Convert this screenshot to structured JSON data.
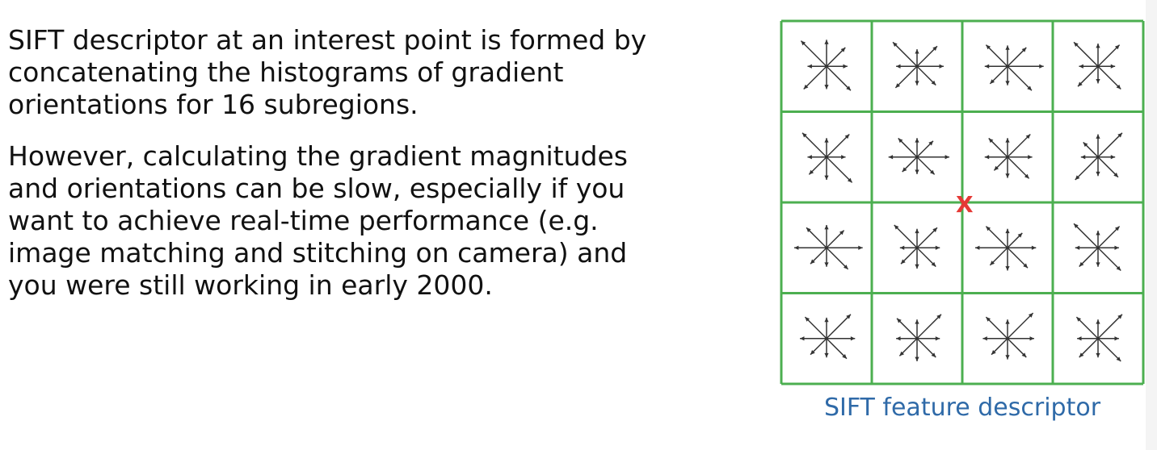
{
  "text": {
    "paragraphs": [
      [
        "SIFT descriptor at an interest point is formed by",
        "concatenating the histograms of gradient",
        "orientations for 16 subregions."
      ],
      [
        "However, calculating the gradient magnitudes",
        "and orientations can be slow, especially if you",
        "want to achieve real-time performance (e.g.",
        "image matching and stitching on camera) and",
        "you were still working in early 2000."
      ]
    ]
  },
  "figure": {
    "grid_color": "#4caf50",
    "arrow_color": "#333333",
    "center_marker": "X",
    "center_marker_color": "#e53935",
    "caption": "SIFT feature descriptor",
    "cells": [
      [
        [
          0.55,
          0.7,
          0.7,
          0.95,
          0.5,
          0.85,
          0.6,
          0.9
        ],
        [
          0.7,
          0.75,
          0.45,
          0.9,
          0.55,
          0.8,
          0.5,
          0.7
        ],
        [
          0.95,
          0.7,
          0.55,
          0.8,
          0.6,
          0.65,
          0.5,
          0.9
        ],
        [
          0.45,
          0.8,
          0.6,
          0.9,
          0.5,
          0.75,
          0.45,
          0.85
        ]
      ],
      [
        [
          0.5,
          0.85,
          0.5,
          0.9,
          0.5,
          0.65,
          0.6,
          0.95
        ],
        [
          0.85,
          0.6,
          0.5,
          0.7,
          0.75,
          0.55,
          0.45,
          0.65
        ],
        [
          0.65,
          0.85,
          0.5,
          0.7,
          0.6,
          0.5,
          0.55,
          0.8
        ],
        [
          0.45,
          0.9,
          0.6,
          0.55,
          0.45,
          0.85,
          0.5,
          0.75
        ]
      ],
      [
        [
          0.95,
          0.65,
          0.6,
          0.75,
          0.85,
          0.6,
          0.5,
          0.8
        ],
        [
          0.6,
          0.75,
          0.5,
          0.85,
          0.45,
          0.6,
          0.55,
          0.7
        ],
        [
          0.75,
          0.55,
          0.5,
          0.8,
          0.85,
          0.65,
          0.6,
          0.75
        ],
        [
          0.55,
          0.8,
          0.45,
          0.9,
          0.6,
          0.7,
          0.5,
          0.85
        ]
      ],
      [
        [
          0.75,
          0.9,
          0.55,
          0.8,
          0.7,
          0.6,
          0.5,
          0.75
        ],
        [
          0.6,
          0.9,
          0.5,
          0.75,
          0.55,
          0.65,
          0.6,
          0.7
        ],
        [
          0.7,
          0.95,
          0.5,
          0.8,
          0.65,
          0.6,
          0.55,
          0.7
        ],
        [
          0.55,
          0.9,
          0.5,
          0.8,
          0.55,
          0.7,
          0.5,
          0.85
        ]
      ]
    ]
  }
}
